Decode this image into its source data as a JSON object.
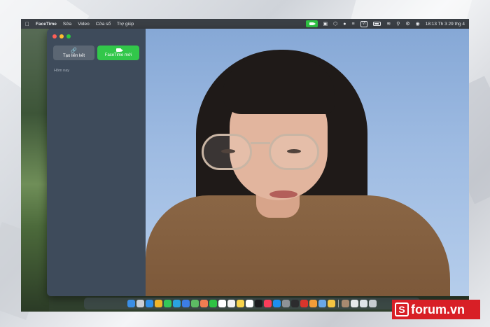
{
  "menubar": {
    "app_name": "FaceTime",
    "menus": [
      "Sửa",
      "Video",
      "Cửa sổ",
      "Trợ giúp"
    ],
    "language_indicator": "VI",
    "clock": "18:13 Th 3 29 thg 4",
    "icons": [
      "apple-icon",
      "facetime-camera-icon",
      "display-icon",
      "layers-icon",
      "user-icon",
      "keyboard-language-icon",
      "battery-icon",
      "wifi-icon",
      "search-icon",
      "control-center-icon",
      "siri-icon"
    ]
  },
  "sidebar": {
    "create_link_label": "Tạo liên kết",
    "new_facetime_label": "FaceTime mới",
    "section_title": "Hôm nay"
  },
  "dock": {
    "apps": [
      {
        "name": "finder",
        "color": "#3a8ee6"
      },
      {
        "name": "launchpad",
        "color": "#c9ced6"
      },
      {
        "name": "safari",
        "color": "#2f8fe8"
      },
      {
        "name": "chrome",
        "color": "#f0b429"
      },
      {
        "name": "messages",
        "color": "#34c759"
      },
      {
        "name": "telegram",
        "color": "#2aa3e0"
      },
      {
        "name": "mail",
        "color": "#3d7ee6"
      },
      {
        "name": "maps",
        "color": "#5dbb63"
      },
      {
        "name": "photos",
        "color": "#f27d52"
      },
      {
        "name": "facetime",
        "color": "#2fc243"
      },
      {
        "name": "calendar",
        "color": "#ffffff"
      },
      {
        "name": "reminders",
        "color": "#f2f2f2"
      },
      {
        "name": "notes",
        "color": "#f7d34b"
      },
      {
        "name": "freeform",
        "color": "#ffffff"
      },
      {
        "name": "apple-tv",
        "color": "#1c1c1e"
      },
      {
        "name": "music",
        "color": "#fa3d5a"
      },
      {
        "name": "app-store",
        "color": "#1e8ff0"
      },
      {
        "name": "system-settings",
        "color": "#8e9297"
      },
      {
        "name": "terminal",
        "color": "#2c2c2e"
      },
      {
        "name": "acrobat",
        "color": "#d9352c"
      },
      {
        "name": "books",
        "color": "#f29c38"
      },
      {
        "name": "preview",
        "color": "#6aa7e8"
      },
      {
        "name": "notes-app",
        "color": "#f5c542"
      }
    ],
    "recent_apps": [
      {
        "name": "photo-thumbnail",
        "color": "#a88a70"
      },
      {
        "name": "window-thumbnail",
        "color": "#e6e8eb"
      },
      {
        "name": "downloads",
        "color": "#dfe3e8"
      },
      {
        "name": "trash",
        "color": "#c8ccd2"
      }
    ]
  },
  "watermark": {
    "brand_text": "forum.vn",
    "brand_mark": "S",
    "brand_color": "#d81f26"
  },
  "colors": {
    "accent_green": "#32c74a",
    "sidebar_bg": "#3e4b5b"
  }
}
